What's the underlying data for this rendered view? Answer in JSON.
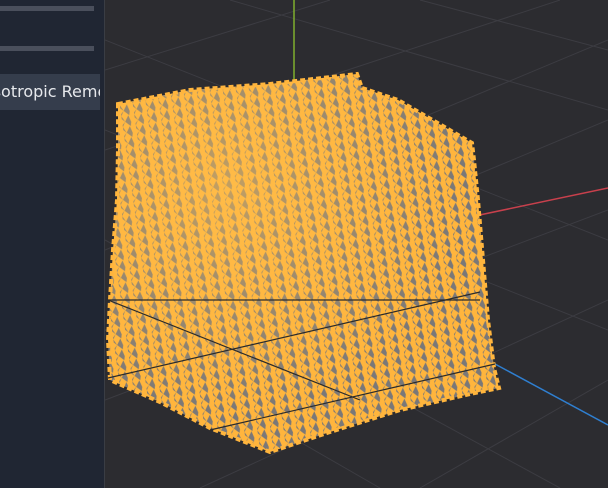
{
  "sidebar": {
    "remesh_button_label": "Isotropic Remesh"
  },
  "viewport": {
    "axes": {
      "x_color": "#c8404c",
      "y_color": "#7fae2e",
      "z_color": "#2f7fd0"
    },
    "mesh_color": "#ffb53d",
    "mesh_gap_color": "#7a7878",
    "grid_color": "#3c3c42",
    "background": "#2c2c30"
  }
}
